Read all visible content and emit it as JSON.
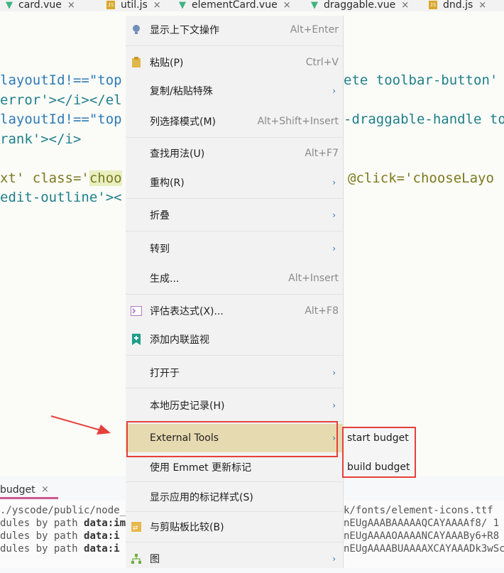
{
  "tabs": [
    {
      "label": "card.vue",
      "icon": "vue-icon"
    },
    {
      "label": "util.js",
      "icon": "js-icon"
    },
    {
      "label": "elementCard.vue",
      "icon": "vue-icon"
    },
    {
      "label": "draggable.vue",
      "icon": "vue-icon"
    },
    {
      "label": "dnd.js",
      "icon": "js-icon"
    }
  ],
  "code": {
    "line1_left": "layoutId!==\"top",
    "line1_right": "ete toolbar-button'",
    "line2_left": "error'></i></el",
    "line3_left": "layoutId!==\"top",
    "line3_right": "-draggable-handle to",
    "line4_left": "rank'></i>",
    "line5_left_a": "xt' class='",
    "line5_left_b": "choo",
    "line5_right": "@click='chooseLayo",
    "line6_left": "edit-outline'><"
  },
  "context_menu": {
    "items": [
      {
        "label": "显示上下文操作",
        "shortcut": "Alt+Enter",
        "icon": "bulb-icon"
      },
      {
        "label": "粘贴(P)",
        "shortcut": "Ctrl+V",
        "icon": "clipboard-icon"
      },
      {
        "label": "复制/粘贴特殊",
        "shortcut": "",
        "submenu": true
      },
      {
        "label": "列选择模式(M)",
        "shortcut": "Alt+Shift+Insert"
      },
      {
        "label": "查找用法(U)",
        "shortcut": "Alt+F7"
      },
      {
        "label": "重构(R)",
        "shortcut": "",
        "submenu": true
      },
      {
        "label": "折叠",
        "shortcut": "",
        "submenu": true
      },
      {
        "label": "转到",
        "shortcut": "",
        "submenu": true
      },
      {
        "label": "生成...",
        "shortcut": "Alt+Insert"
      },
      {
        "label": "评估表达式(X)...",
        "shortcut": "Alt+F8",
        "icon": "console-icon"
      },
      {
        "label": "添加内联监视",
        "shortcut": "",
        "icon": "bookmark-plus-icon"
      },
      {
        "label": "打开于",
        "shortcut": "",
        "submenu": true
      },
      {
        "label": "本地历史记录(H)",
        "shortcut": "",
        "submenu": true
      },
      {
        "label": "External Tools",
        "shortcut": "",
        "submenu": true,
        "active": true
      },
      {
        "label": "使用 Emmet 更新标记",
        "shortcut": ""
      },
      {
        "label": "显示应用的标记样式(S)",
        "shortcut": ""
      },
      {
        "label": "与剪贴板比较(B)",
        "shortcut": "",
        "icon": "compare-icon"
      },
      {
        "label": "图",
        "shortcut": "",
        "submenu": true,
        "icon": "diagram-icon"
      }
    ]
  },
  "submenu": {
    "items": [
      "start budget",
      "build budget"
    ]
  },
  "bottom_tab": {
    "label": "budget"
  },
  "console": {
    "line1_left": "./yscode/public/node_",
    "line1_right": "k/fonts/element-icons.ttf",
    "line2_left_a": "dules by path ",
    "line2_left_b": "data:imag",
    "line2_right": "nEUgAAABAAAAAQCAYAAAAf8/ 1",
    "line3_left_a": "dules by path ",
    "line3_left_b": "data:i",
    "line3_right": "nEUgAAAAOAAAANCAYAAABy6+R8",
    "line4_left_a": "dules by path ",
    "line4_left_b": "data:i",
    "line4_right": "nEUgAAAABUAAAAXCAYAAADk3wSc"
  },
  "colors": {
    "highlight": "#e6dab0",
    "annotation_red": "#e5403a",
    "arrow_blue": "#3a6fb0"
  }
}
